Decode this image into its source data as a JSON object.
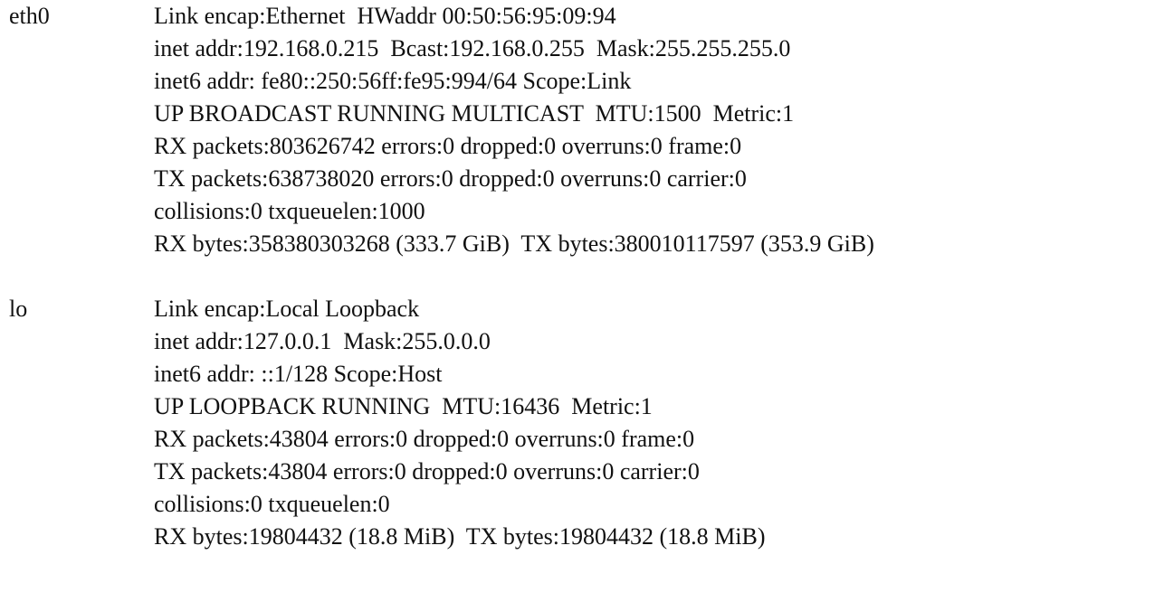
{
  "colors": {
    "background": "#ffffff",
    "text": "#111111"
  },
  "interfaces": [
    {
      "name": "eth0",
      "lines": [
        "Link encap:Ethernet  HWaddr 00:50:56:95:09:94",
        "inet addr:192.168.0.215  Bcast:192.168.0.255  Mask:255.255.255.0",
        "inet6 addr: fe80::250:56ff:fe95:994/64 Scope:Link",
        "UP BROADCAST RUNNING MULTICAST  MTU:1500  Metric:1",
        "RX packets:803626742 errors:0 dropped:0 overruns:0 frame:0",
        "TX packets:638738020 errors:0 dropped:0 overruns:0 carrier:0",
        "collisions:0 txqueuelen:1000",
        "RX bytes:358380303268 (333.7 GiB)  TX bytes:380010117597 (353.9 GiB)"
      ]
    },
    {
      "name": "lo",
      "lines": [
        "Link encap:Local Loopback",
        "inet addr:127.0.0.1  Mask:255.0.0.0",
        "inet6 addr: ::1/128 Scope:Host",
        "UP LOOPBACK RUNNING  MTU:16436  Metric:1",
        "RX packets:43804 errors:0 dropped:0 overruns:0 frame:0",
        "TX packets:43804 errors:0 dropped:0 overruns:0 carrier:0",
        "collisions:0 txqueuelen:0",
        "RX bytes:19804432 (18.8 MiB)  TX bytes:19804432 (18.8 MiB)"
      ]
    }
  ]
}
